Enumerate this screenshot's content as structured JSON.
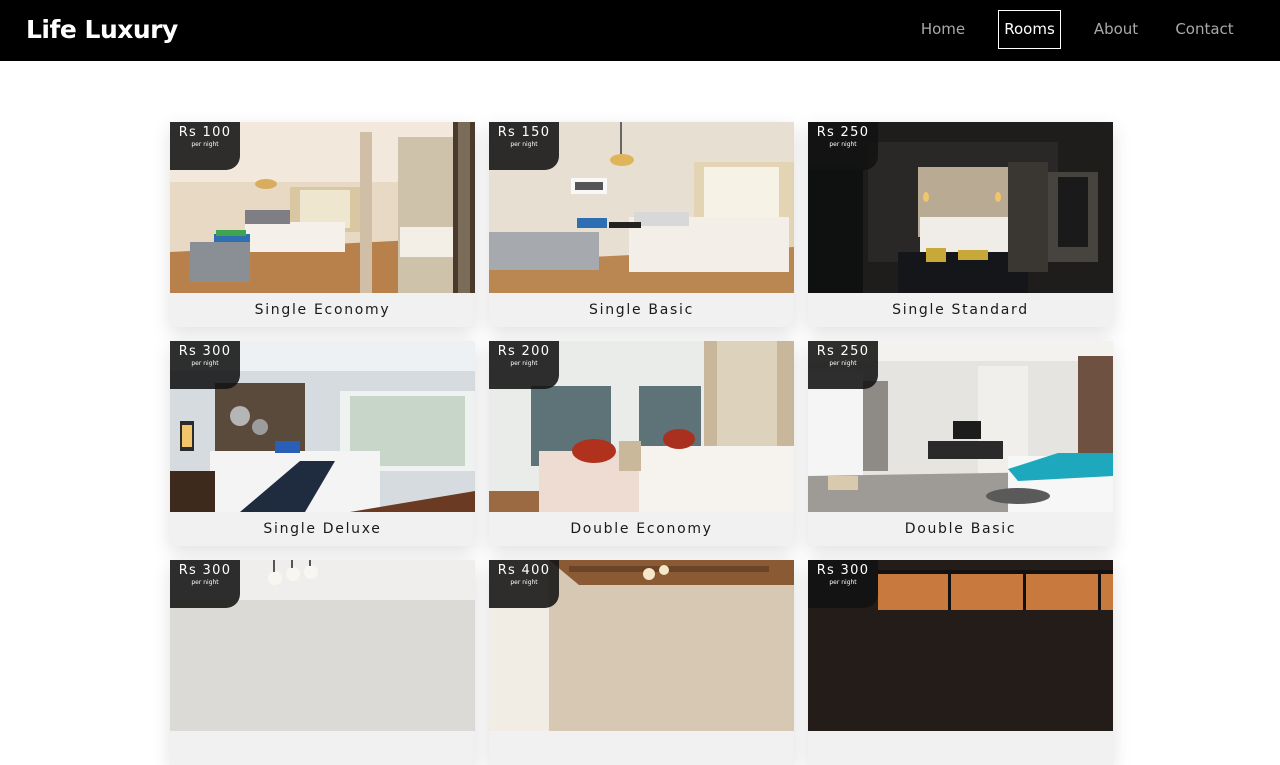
{
  "nav": {
    "brand": "Life Luxury",
    "links": [
      {
        "label": "Home",
        "active": false
      },
      {
        "label": "Rooms",
        "active": true
      },
      {
        "label": "About",
        "active": false
      },
      {
        "label": "Contact",
        "active": false
      }
    ]
  },
  "rooms": [
    {
      "name": "Single Economy",
      "price": "Rs 100",
      "unit": "per night"
    },
    {
      "name": "Single Basic",
      "price": "Rs 150",
      "unit": "per night"
    },
    {
      "name": "Single Standard",
      "price": "Rs 250",
      "unit": "per night"
    },
    {
      "name": "Single Deluxe",
      "price": "Rs 300",
      "unit": "per night"
    },
    {
      "name": "Double Economy",
      "price": "Rs 200",
      "unit": "per night"
    },
    {
      "name": "Double Basic",
      "price": "Rs 250",
      "unit": "per night"
    },
    {
      "name": "",
      "price": "Rs 300",
      "unit": "per night"
    },
    {
      "name": "",
      "price": "Rs 400",
      "unit": "per night"
    },
    {
      "name": "",
      "price": "Rs 300",
      "unit": "per night"
    }
  ],
  "colors": {
    "navbar": "#000000",
    "nav_active": "#ffffff",
    "nav_inactive": "#a9a9a9",
    "card_footer": "#f1f1f2",
    "badge": "#121212"
  }
}
